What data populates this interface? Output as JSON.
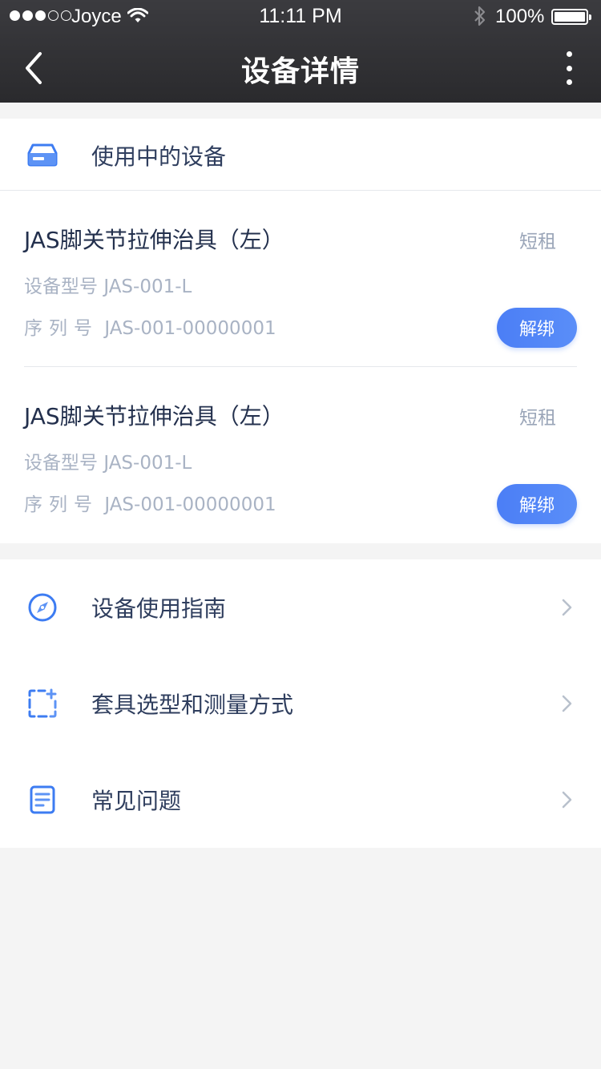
{
  "status_bar": {
    "carrier": "Joyce",
    "time": "11:11 PM",
    "battery": "100%",
    "signal_bars_filled": 3,
    "signal_bars_total": 5,
    "battery_level": 1.0
  },
  "nav": {
    "title": "设备详情",
    "back_icon": "chevron-left-icon",
    "more_icon": "more-vertical-icon"
  },
  "devices_section": {
    "title": "使用中的设备",
    "icon": "device-icon",
    "items": [
      {
        "name": "JAS脚关节拉伸治具（左）",
        "tag": "短租",
        "model_label": "设备型号",
        "model": "JAS-001-L",
        "serial_label": "序列号",
        "serial": "JAS-001-00000001",
        "action": "解绑"
      },
      {
        "name": "JAS脚关节拉伸治具（左）",
        "tag": "短租",
        "model_label": "设备型号",
        "model": "JAS-001-L",
        "serial_label": "序列号",
        "serial": "JAS-001-00000001",
        "action": "解绑"
      }
    ]
  },
  "menu": [
    {
      "label": "设备使用指南",
      "icon": "compass-icon"
    },
    {
      "label": "套具选型和测量方式",
      "icon": "measure-frame-icon"
    },
    {
      "label": "常见问题",
      "icon": "document-icon"
    }
  ],
  "colors": {
    "accent": "#4b7ef6",
    "header_bg": "#2f2f32",
    "title_text": "#23304d",
    "muted_text": "#a9b3c4",
    "page_bg": "#f4f4f4"
  }
}
